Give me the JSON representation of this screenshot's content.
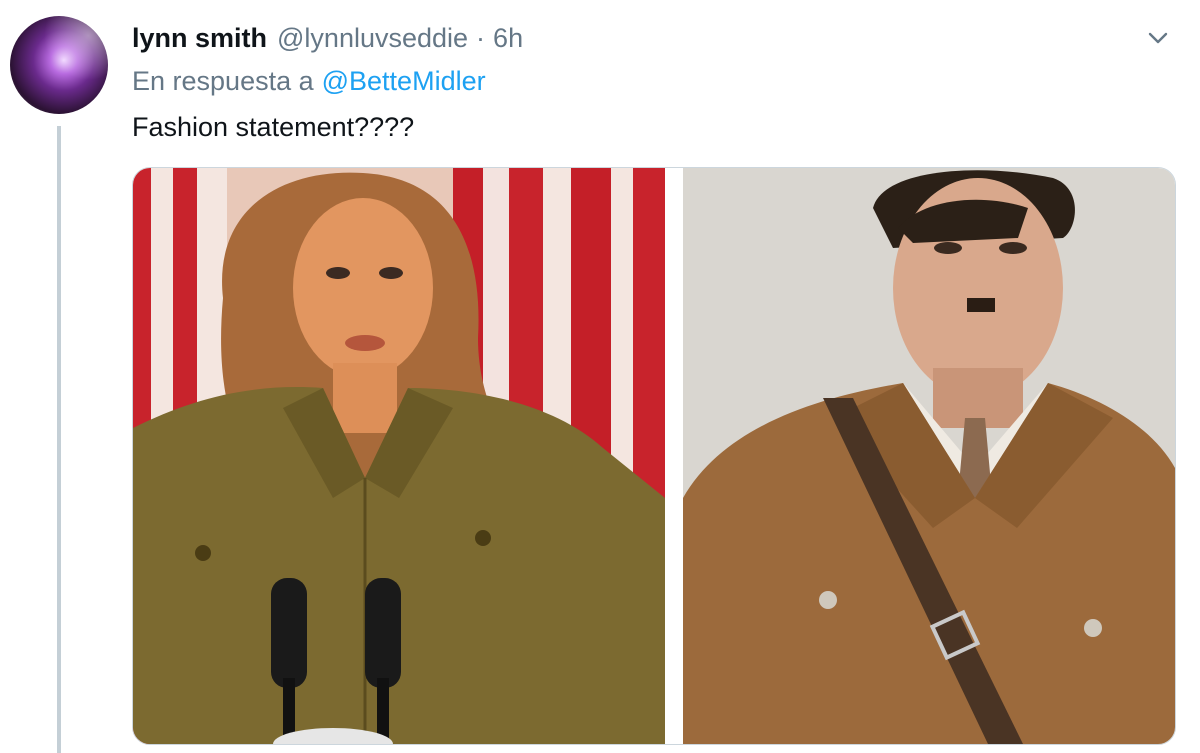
{
  "tweet": {
    "display_name": "lynn smith",
    "handle": "@lynnluvseddie",
    "separator": "·",
    "time": "6h",
    "reply_prefix": "En respuesta a",
    "reply_to": "@BetteMidler",
    "text": "Fashion statement????"
  },
  "icons": {
    "more": "chevron-down-icon"
  },
  "media": {
    "images": [
      {
        "name": "woman-at-podium-photo"
      },
      {
        "name": "man-in-uniform-painting"
      }
    ]
  },
  "colors": {
    "link": "#1da1f2",
    "muted": "#657786",
    "text": "#0f1419"
  }
}
